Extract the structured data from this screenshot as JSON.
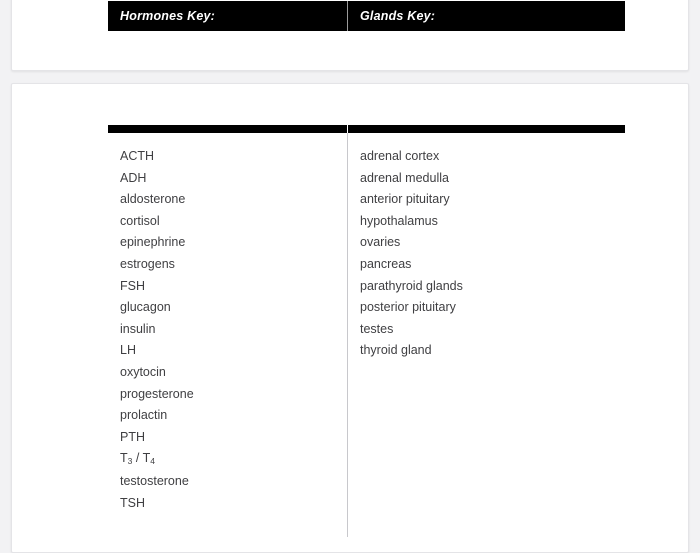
{
  "colors": {
    "page_background": "#f2f2f4",
    "card_background": "#ffffff",
    "rule": "#000000",
    "header_text": "#ffffff",
    "item_text": "#3f3f42",
    "divider": "#c8c8cc"
  },
  "header": {
    "hormones_key_label": "Hormones Key:",
    "glands_key_label": "Glands Key:"
  },
  "table": {
    "columns": [
      {
        "id": "hormones",
        "header": "Hormones Key:",
        "items": [
          "ACTH",
          "ADH",
          "aldosterone",
          "cortisol",
          "epinephrine",
          "estrogens",
          "FSH",
          "glucagon",
          "insulin",
          "LH",
          "oxytocin",
          "progesterone",
          "prolactin",
          "PTH",
          "T3 / T4",
          "testosterone",
          "TSH"
        ]
      },
      {
        "id": "glands",
        "header": "Glands Key:",
        "items": [
          "adrenal cortex",
          "adrenal medulla",
          "anterior pituitary",
          "hypothalamus",
          "ovaries",
          "pancreas",
          "parathyroid glands",
          "posterior pituitary",
          "testes",
          "thyroid gland"
        ]
      }
    ]
  }
}
